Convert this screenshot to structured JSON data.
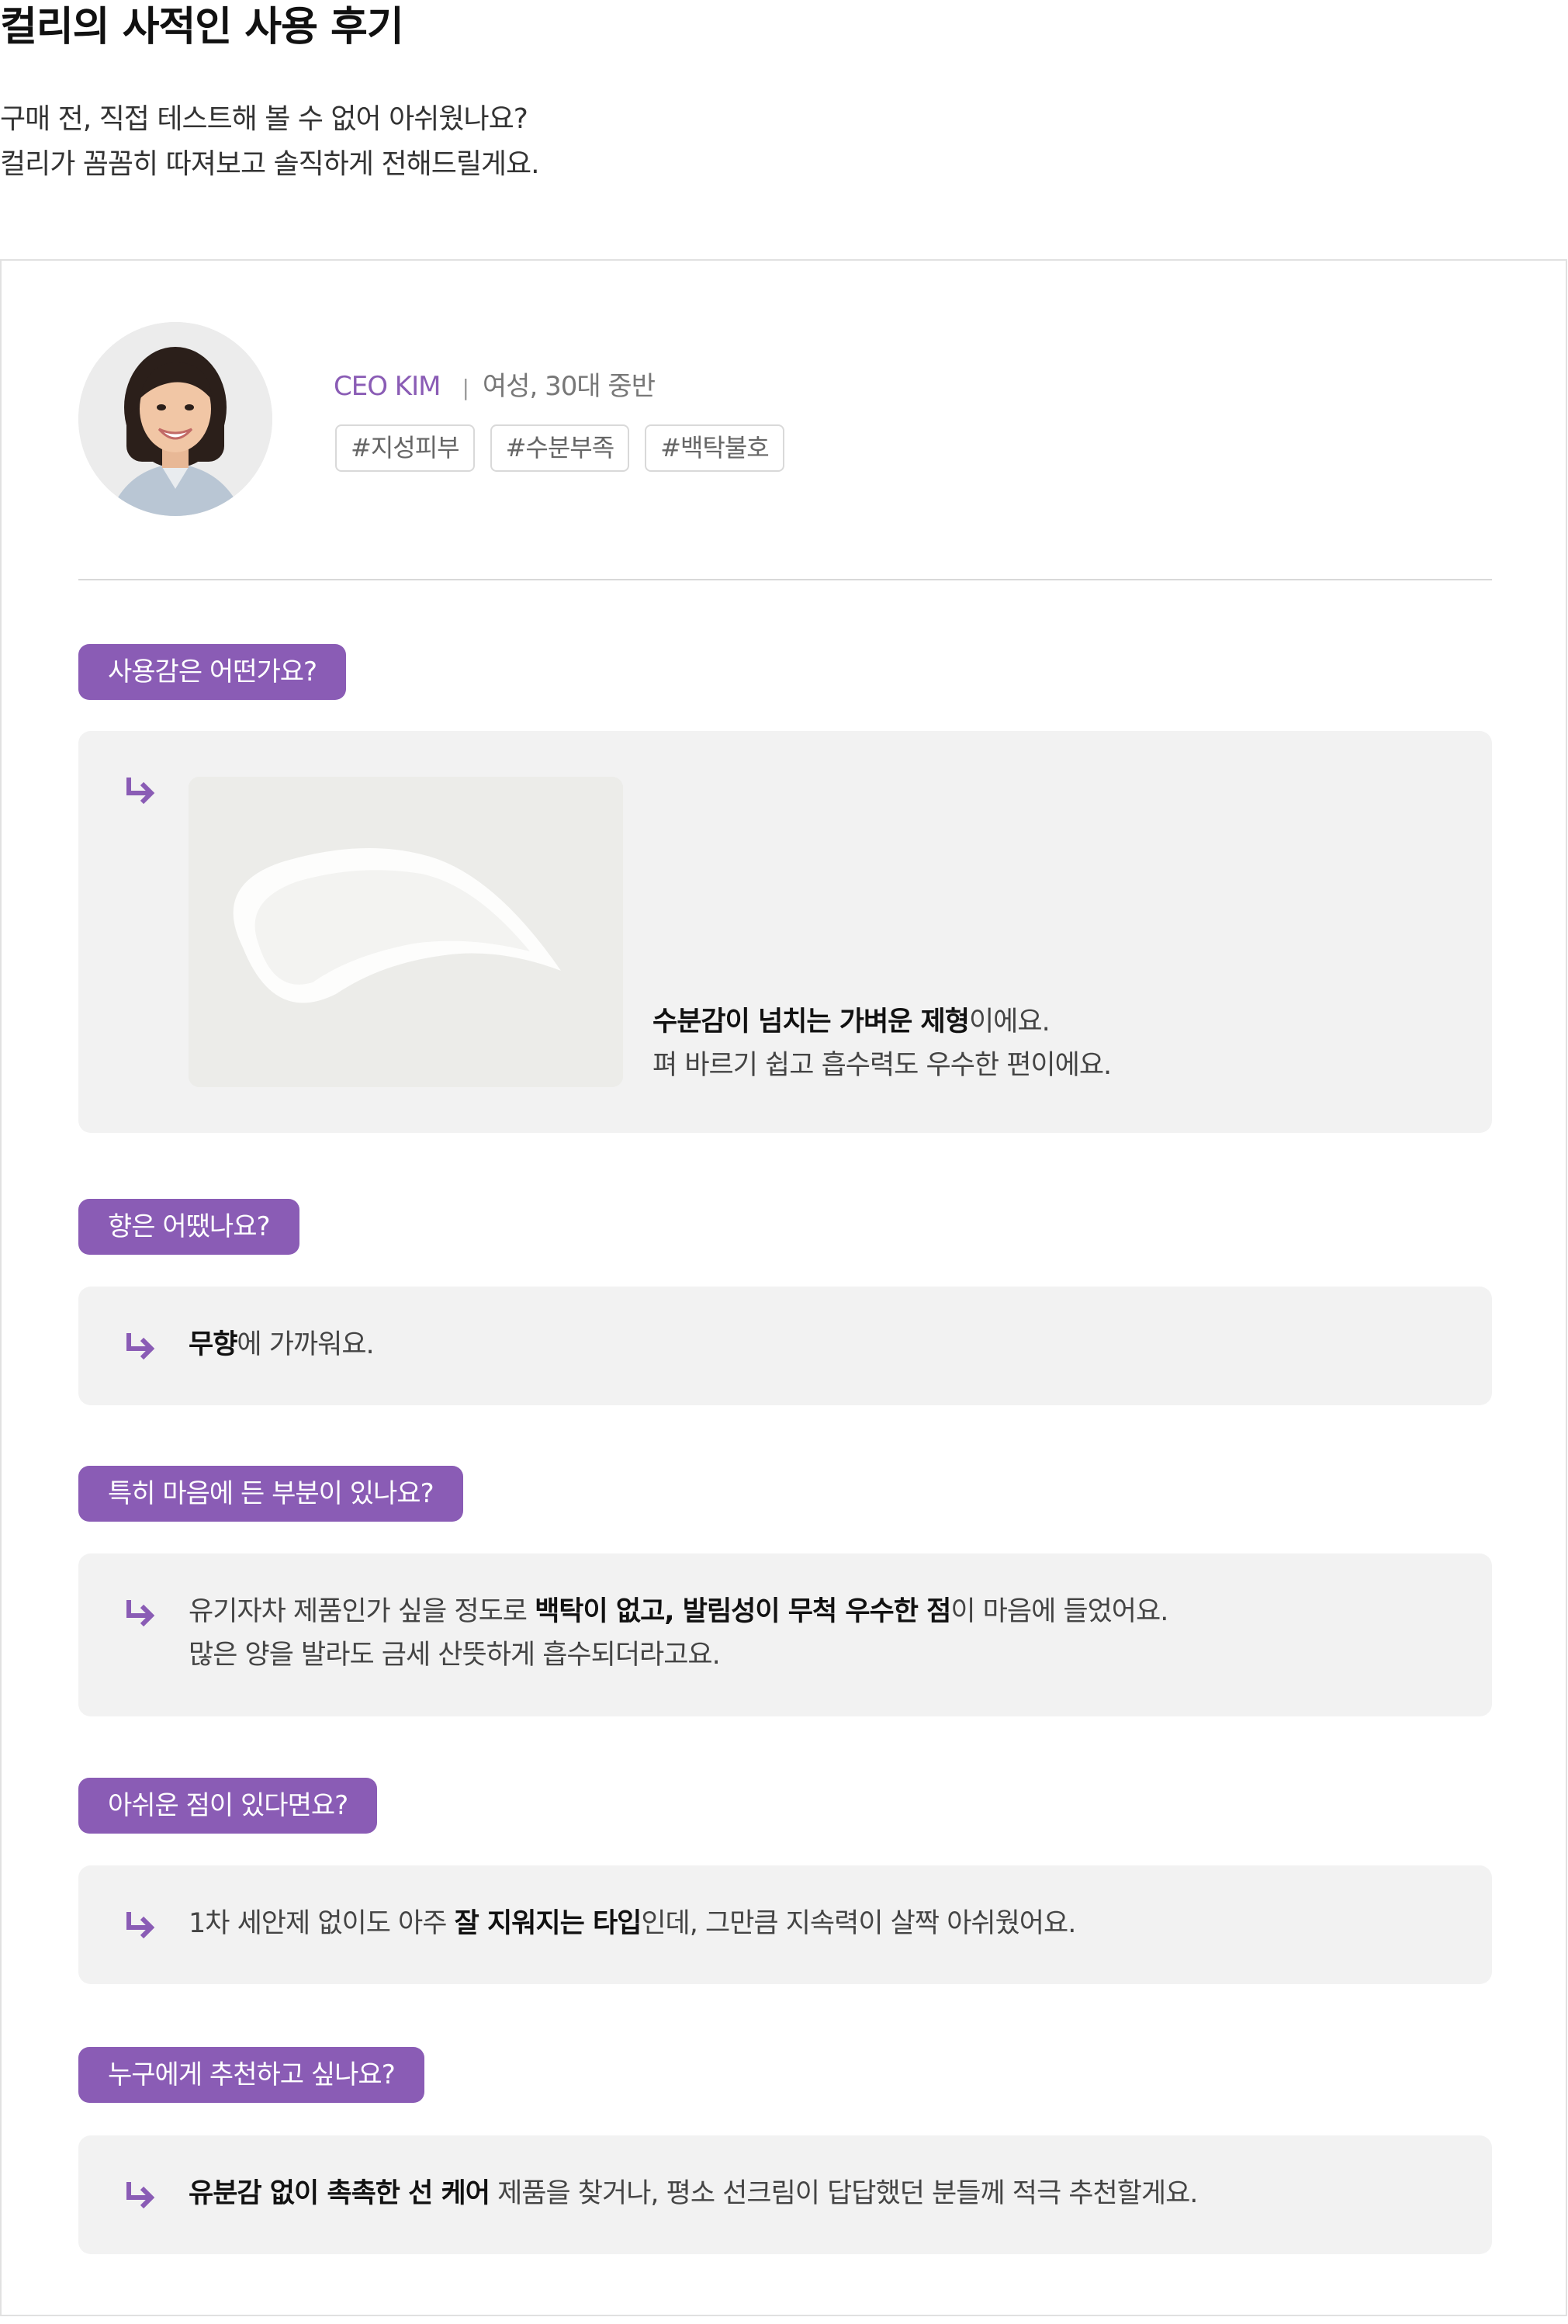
{
  "header": {
    "title": "컬리의 사적인 사용 후기",
    "intro_line1": "구매 전, 직접 테스트해 볼 수 없어 아쉬웠나요?",
    "intro_line2": "컬리가 꼼꼼히 따져보고 솔직하게 전해드릴게요."
  },
  "reviewer": {
    "name": "CEO KIM",
    "separator": "|",
    "meta": "여성, 30대 중반",
    "tags": [
      "#지성피부",
      "#수분부족",
      "#백탁불호"
    ]
  },
  "qa": [
    {
      "question": "사용감은 어떤가요?",
      "line1": {
        "bold": "수분감이 넘치는 가벼운 제형",
        "rest": "이에요."
      },
      "line2": "펴 바르기 쉽고 흡수력도 우수한 편이에요."
    },
    {
      "question": "향은 어땠나요?",
      "line1": {
        "bold": "무향",
        "rest": "에 가까워요."
      }
    },
    {
      "question": "특히 마음에 든 부분이 있나요?",
      "line1": {
        "pre": "유기자차 제품인가 싶을 정도로 ",
        "bold": "백탁이 없고, 발림성이 무척 우수한 점",
        "rest": "이 마음에 들었어요."
      },
      "line2": "많은 양을 발라도 금세 산뜻하게 흡수되더라고요."
    },
    {
      "question": "아쉬운 점이 있다면요?",
      "line1": {
        "pre": "1차 세안제 없이도 아주 ",
        "bold": "잘 지워지는 타입",
        "rest": "인데, 그만큼 지속력이 살짝 아쉬웠어요."
      }
    },
    {
      "question": "누구에게 추천하고 싶나요?",
      "line1": {
        "bold": "유분감 없이 촉촉한 선 케어",
        "rest": " 제품을 찾거나, 평소 선크림이 답답했던 분들께 적극 추천할게요."
      }
    }
  ],
  "colors": {
    "accent": "#8a5cb5",
    "answer_bg": "#f2f2f2",
    "border": "#e1e1e1"
  },
  "icons": {
    "answer_marker": "arrow-return-right-icon"
  }
}
